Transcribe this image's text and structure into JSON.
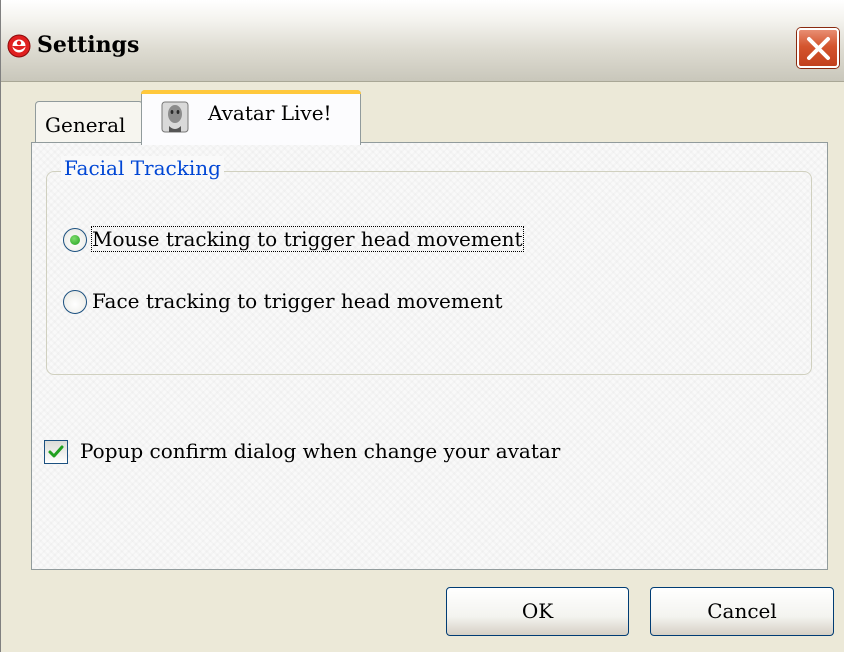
{
  "window": {
    "title": "Settings",
    "icon": "app-logo-icon",
    "close_icon": "close-icon"
  },
  "tabs": [
    {
      "label": "General",
      "active": false
    },
    {
      "label": "Avatar Live!",
      "active": true,
      "icon": "avatar-icon"
    }
  ],
  "facial_tracking": {
    "legend": "Facial Tracking",
    "options": [
      {
        "label": "Mouse tracking to trigger head movement",
        "selected": true
      },
      {
        "label": "Face tracking to trigger head movement",
        "selected": false
      }
    ]
  },
  "popup_confirm": {
    "label": "Popup confirm dialog when change your avatar",
    "checked": true
  },
  "buttons": {
    "ok": "OK",
    "cancel": "Cancel"
  },
  "colors": {
    "legend_text": "#0046d5",
    "radio_dot": "#21a121",
    "close_button": "#d4552e",
    "active_tab_highlight": "#ffc83c"
  }
}
